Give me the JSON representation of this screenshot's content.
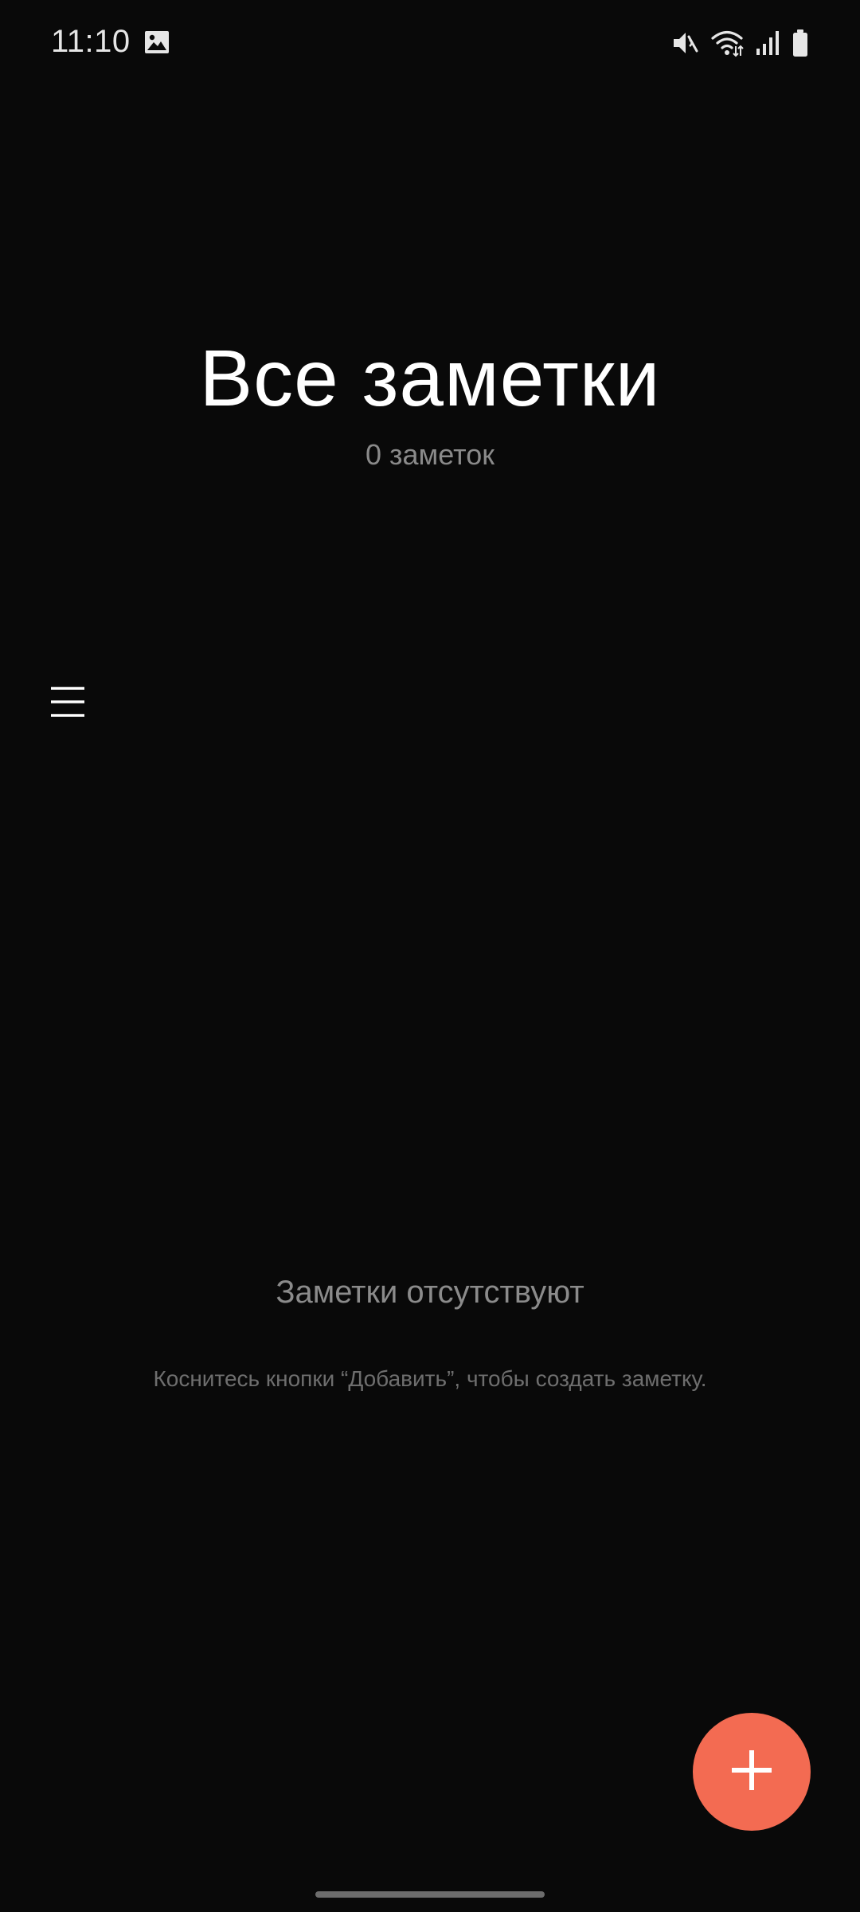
{
  "status_bar": {
    "time": "11:10",
    "icons": [
      "gallery-icon",
      "mute-icon",
      "wifi-icon",
      "signal-icon",
      "battery-icon"
    ]
  },
  "header": {
    "title": "Все заметки",
    "count": "0 заметок"
  },
  "menu": {
    "icon": "hamburger-menu-icon"
  },
  "empty_state": {
    "title": "Заметки отсутствуют",
    "hint": "Коснитесь кнопки “Добавить”, чтобы создать заметку."
  },
  "fab": {
    "icon": "plus-icon",
    "color": "#f36b52"
  },
  "colors": {
    "background": "#090909",
    "title": "#ffffff",
    "subtitle": "#8a8a8a",
    "hint": "#6e6e6e"
  }
}
